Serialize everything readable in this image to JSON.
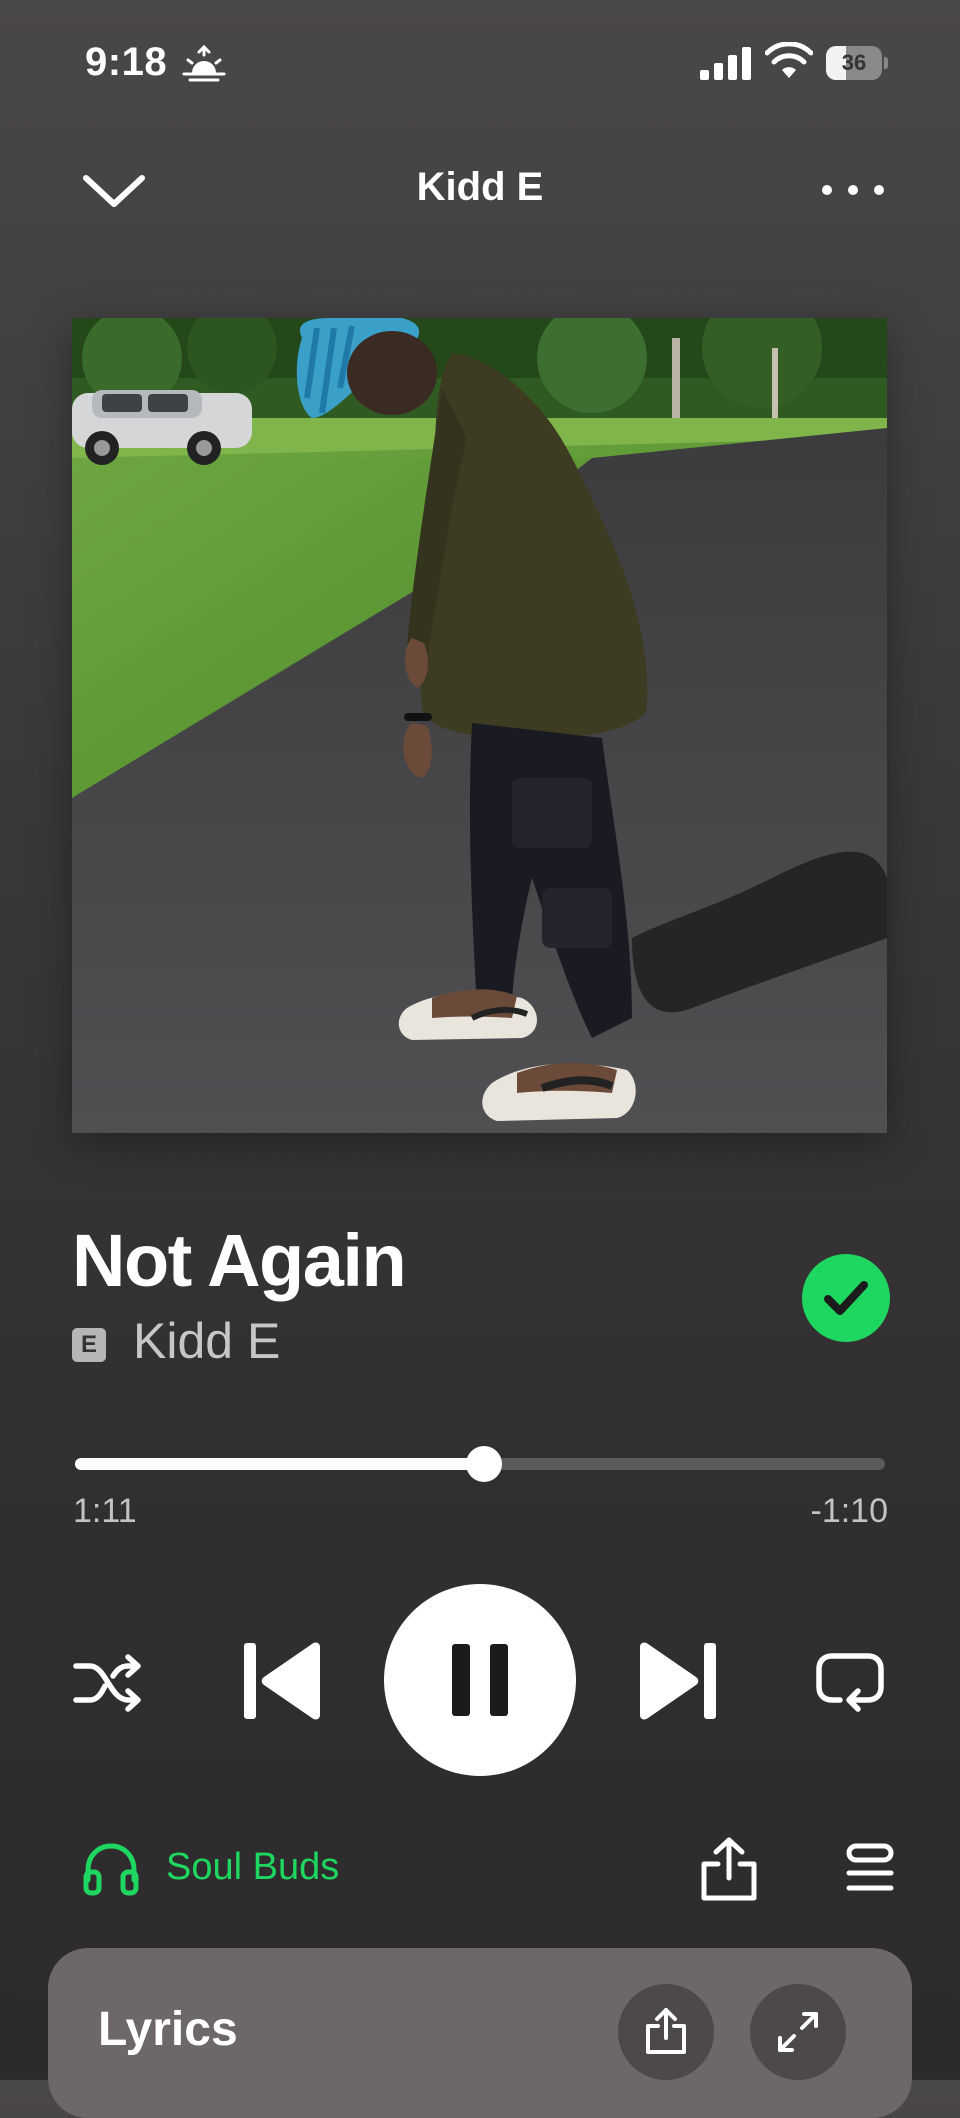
{
  "status_bar": {
    "time": "9:18",
    "battery_level": "36",
    "battery_percent": 36
  },
  "header": {
    "title": "Kidd E"
  },
  "track": {
    "title": "Not Again",
    "artist": "Kidd E",
    "explicit": "E",
    "liked": true
  },
  "playback": {
    "elapsed": "1:11",
    "remaining": "-1:10",
    "progress_percent": 50.5,
    "state": "playing"
  },
  "device": {
    "name": "Soul Buds"
  },
  "lyrics": {
    "label": "Lyrics"
  },
  "colors": {
    "accent": "#1ed760",
    "background": "#3b393a",
    "lyrics_card": "#6d6767"
  },
  "icons": {
    "collapse": "chevron-down-icon",
    "more": "more-horizontal-icon",
    "liked": "check-icon",
    "shuffle": "shuffle-icon",
    "previous": "skip-previous-icon",
    "pause": "pause-icon",
    "next": "skip-next-icon",
    "repeat": "repeat-icon",
    "device": "headphones-icon",
    "share": "share-icon",
    "queue": "queue-icon",
    "expand": "expand-icon"
  }
}
